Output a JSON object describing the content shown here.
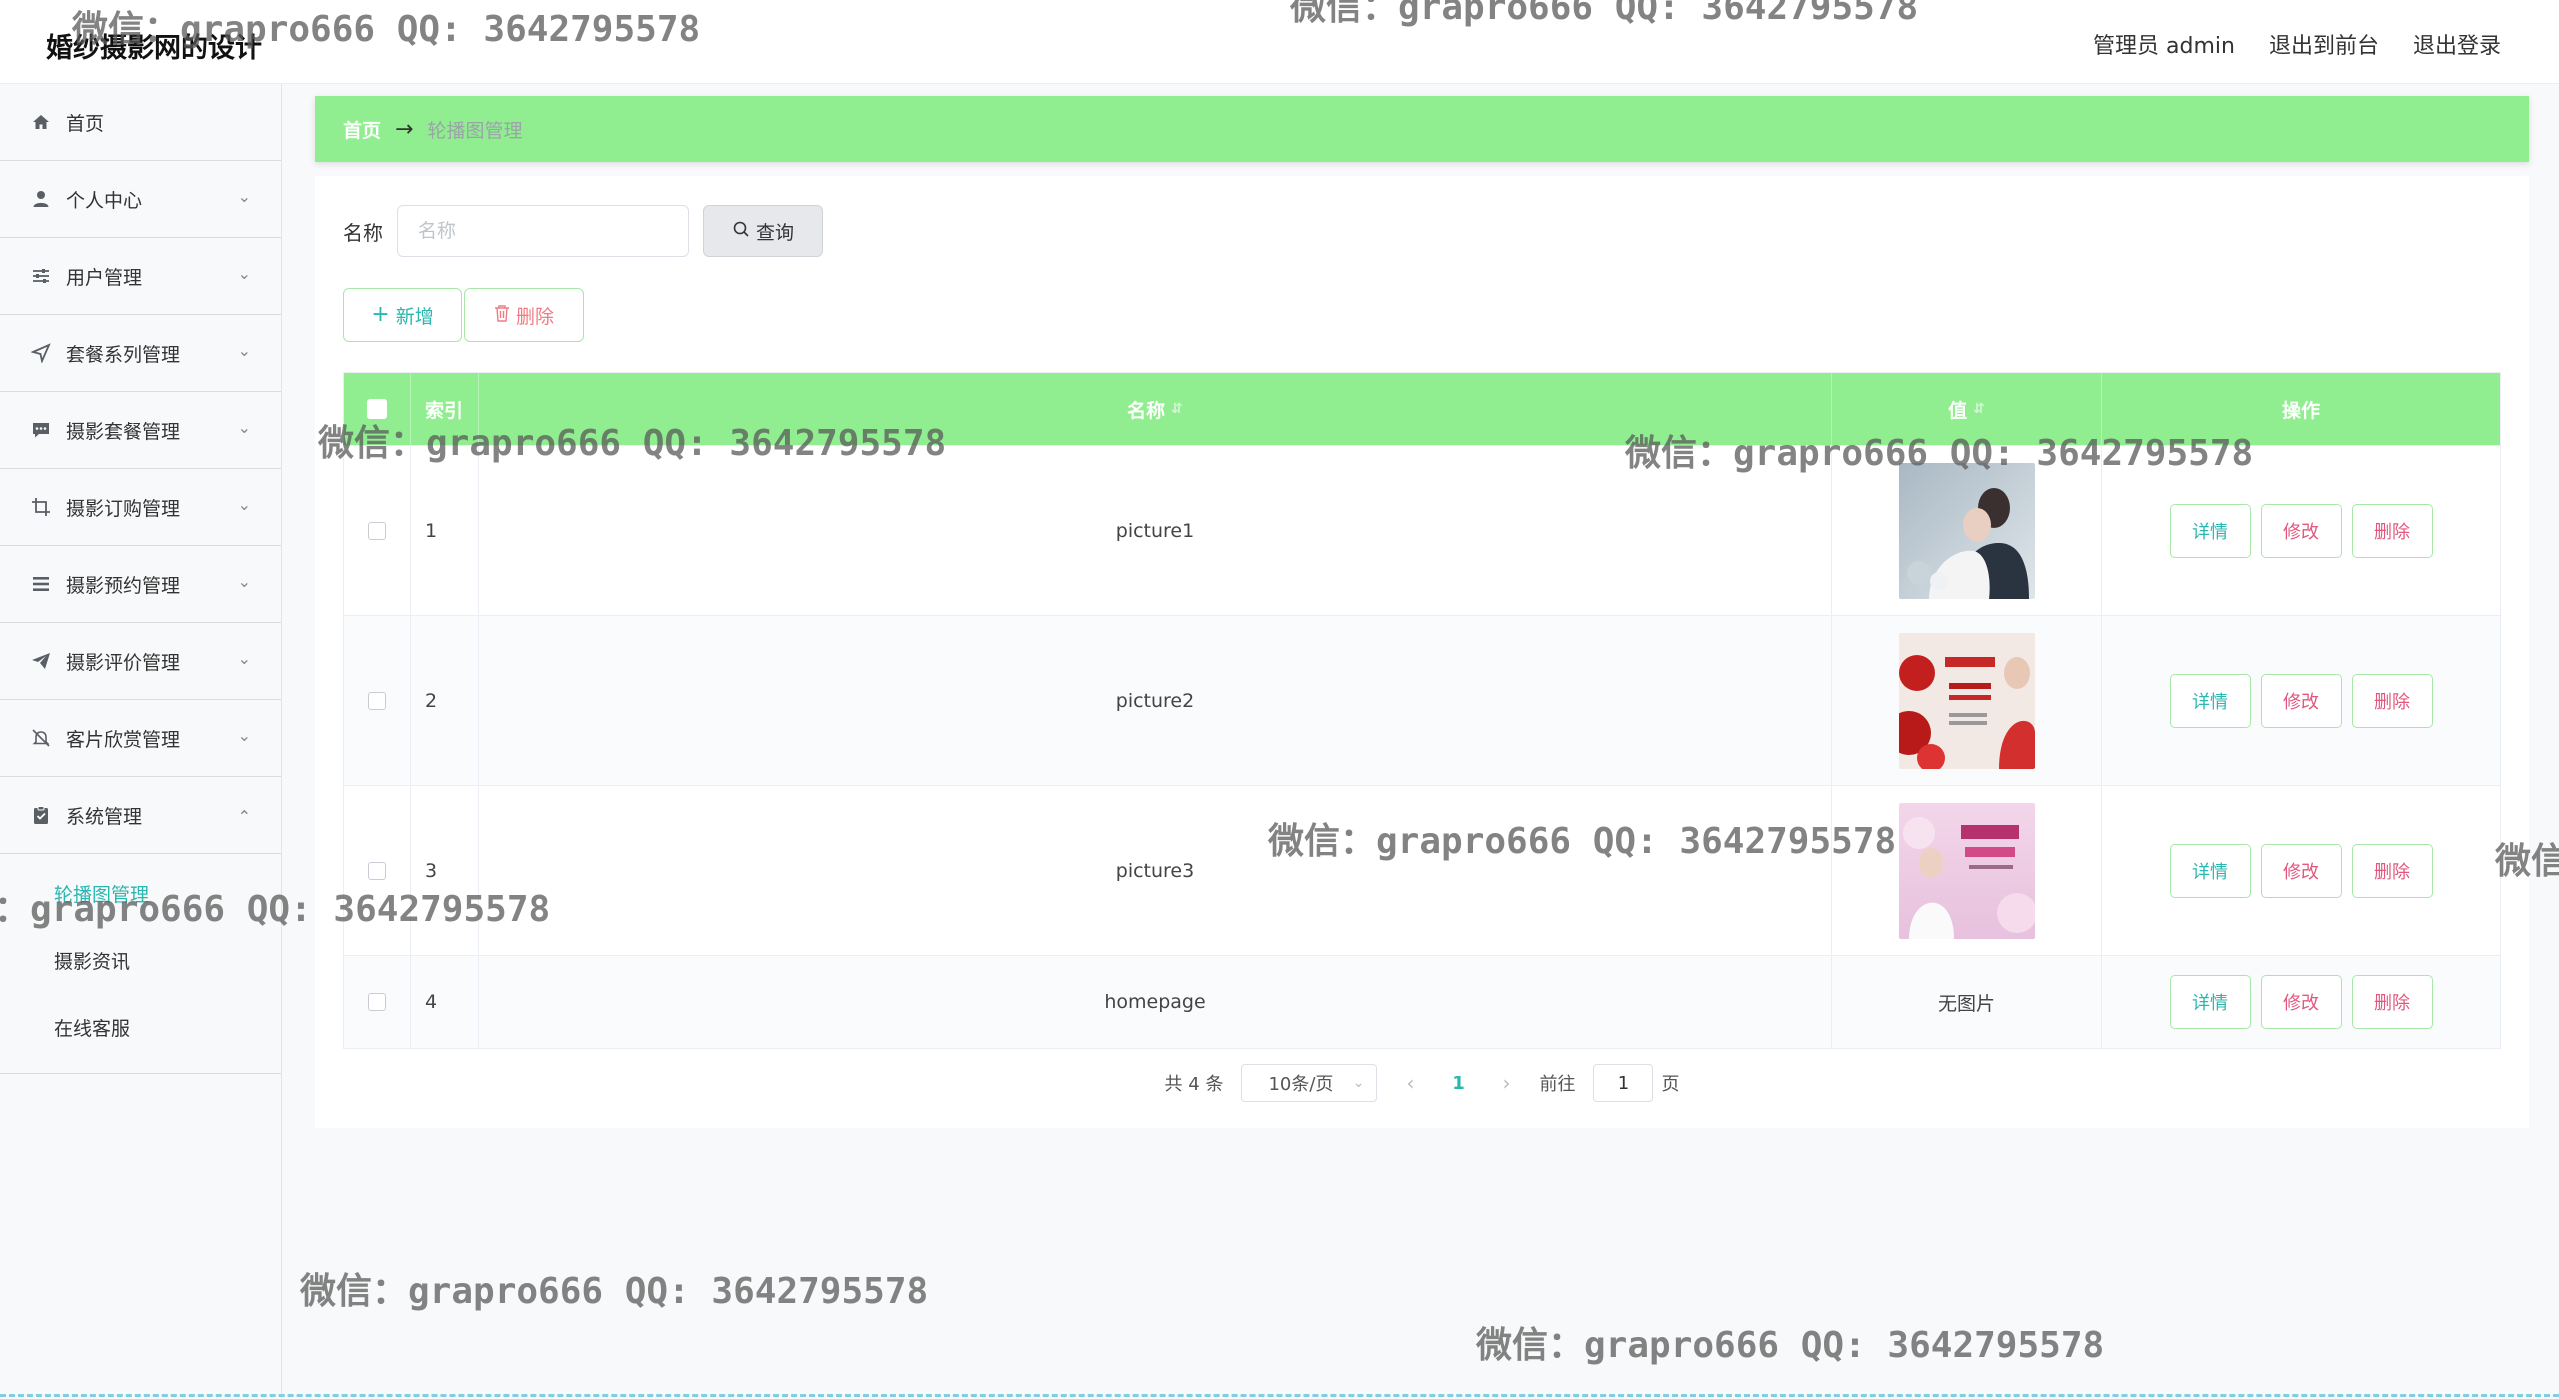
{
  "header": {
    "title": "婚纱摄影网的设计",
    "links": [
      "管理员 admin",
      "退出到前台",
      "退出登录"
    ]
  },
  "sidebar": {
    "items": [
      {
        "label": "首页",
        "icon": "home-icon"
      },
      {
        "label": "个人中心",
        "icon": "user-icon"
      },
      {
        "label": "用户管理",
        "icon": "sliders-icon"
      },
      {
        "label": "套餐系列管理",
        "icon": "send-icon"
      },
      {
        "label": "摄影套餐管理",
        "icon": "chat-icon"
      },
      {
        "label": "摄影订购管理",
        "icon": "crop-icon"
      },
      {
        "label": "摄影预约管理",
        "icon": "list-icon"
      },
      {
        "label": "摄影评价管理",
        "icon": "paper-plane-icon"
      },
      {
        "label": "客片欣赏管理",
        "icon": "bell-off-icon"
      },
      {
        "label": "系统管理",
        "icon": "clipboard-icon"
      }
    ],
    "system_sub": [
      "轮播图管理",
      "摄影资讯",
      "在线客服"
    ]
  },
  "breadcrumb": {
    "home": "首页",
    "arrow": "→",
    "current": "轮播图管理"
  },
  "search": {
    "label": "名称",
    "placeholder": "名称",
    "button": "查询"
  },
  "actions": {
    "add": "新增",
    "delete": "删除"
  },
  "table": {
    "headers": {
      "index": "索引",
      "name": "名称",
      "value": "值",
      "ops": "操作"
    },
    "rows": [
      {
        "index": "1",
        "name": "picture1",
        "value": "",
        "has_image": true
      },
      {
        "index": "2",
        "name": "picture2",
        "value": "",
        "has_image": true
      },
      {
        "index": "3",
        "name": "picture3",
        "value": "",
        "has_image": true
      },
      {
        "index": "4",
        "name": "homepage",
        "value": "无图片",
        "has_image": false
      }
    ],
    "op_labels": {
      "detail": "详情",
      "edit": "修改",
      "delete": "删除"
    }
  },
  "pagination": {
    "total": "共 4 条",
    "page_size": "10条/页",
    "current_page": "1",
    "goto_label": "前往",
    "goto_value": "1",
    "page_suffix": "页"
  },
  "watermark": "微信：grapro666 QQ: 3642795578",
  "colors": {
    "accent": "#90ee90",
    "teal": "#2ab7b0",
    "pink": "#e2577e"
  }
}
